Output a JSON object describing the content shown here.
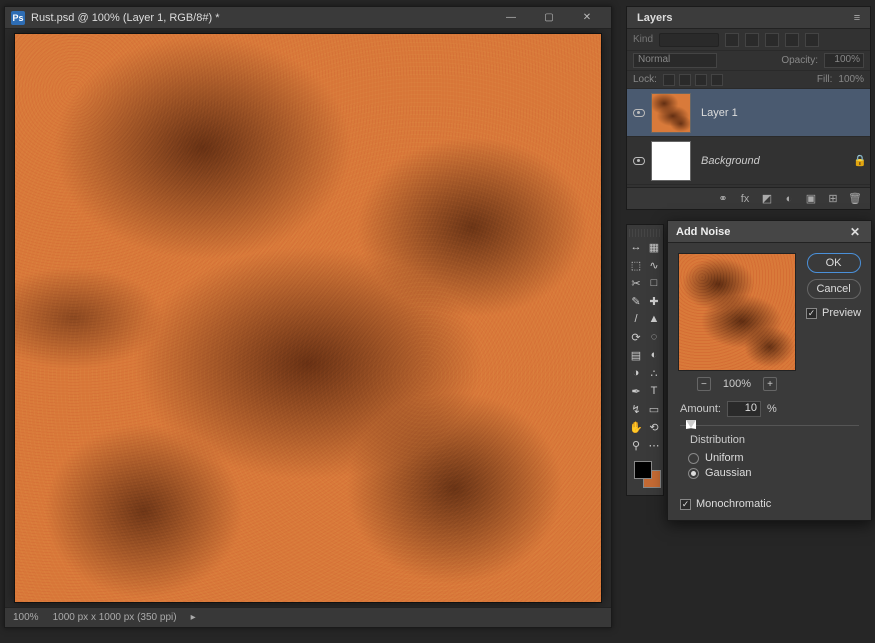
{
  "document": {
    "app_icon_text": "Ps",
    "title": "Rust.psd @ 100% (Layer 1, RGB/8#) *",
    "status_zoom": "100%",
    "status_dims": "1000 px x 1000 px (350 ppi)"
  },
  "layers_panel": {
    "title": "Layers",
    "search_label": "Kind",
    "blend_mode": "Normal",
    "opacity_label": "Opacity:",
    "opacity_value": "100%",
    "lock_label": "Lock:",
    "fill_label": "Fill:",
    "fill_value": "100%",
    "layers": [
      {
        "name": "Layer 1",
        "selected": true,
        "locked": false,
        "thumb": "rust"
      },
      {
        "name": "Background",
        "selected": false,
        "locked": true,
        "thumb": "white"
      }
    ]
  },
  "tools": {
    "items": [
      "move",
      "artboard",
      "marquee",
      "lasso",
      "crop",
      "frame",
      "eyedropper",
      "patch",
      "brush",
      "stamp",
      "history",
      "eraser",
      "gradient",
      "blur",
      "dodge",
      "smudge",
      "pen",
      "type",
      "path",
      "rect",
      "hand",
      "rotate",
      "zoom",
      "more"
    ],
    "glyphs": [
      "↔",
      "▦",
      "⬚",
      "∿",
      "✂",
      "□",
      "✎",
      "✚",
      "/",
      "▲",
      "⟳",
      "◌",
      "▤",
      "◐",
      "◑",
      "∴",
      "✒",
      "T",
      "↯",
      "▭",
      "✋",
      "⟲",
      "⚲",
      "⋯"
    ]
  },
  "dialog": {
    "title": "Add Noise",
    "ok": "OK",
    "cancel": "Cancel",
    "preview_label": "Preview",
    "preview_checked": true,
    "zoom_pct": "100%",
    "amount_label": "Amount:",
    "amount_value": "10",
    "amount_unit": "%",
    "distribution_label": "Distribution",
    "uniform_label": "Uniform",
    "gaussian_label": "Gaussian",
    "distribution_value": "gaussian",
    "mono_label": "Monochromatic",
    "mono_checked": true
  }
}
